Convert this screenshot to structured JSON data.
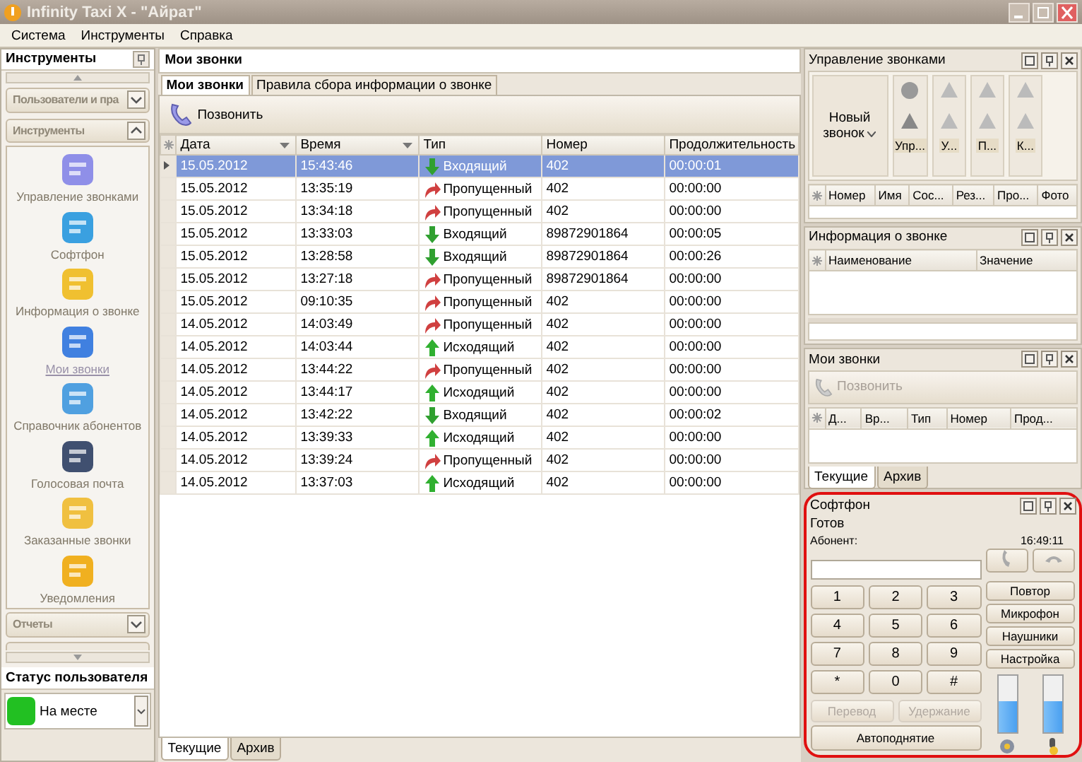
{
  "window": {
    "title": "Infinity Taxi X - \"Айрат\""
  },
  "menu": [
    "Система",
    "Инструменты",
    "Справка"
  ],
  "sidebar": {
    "title": "Инструменты",
    "groups_top": [
      {
        "label": "Пользователи и пра",
        "expanded": false
      },
      {
        "label": "Инструменты",
        "expanded": true
      }
    ],
    "items": [
      {
        "label": "Управление звонками",
        "selected": false
      },
      {
        "label": "Софтфон",
        "selected": false
      },
      {
        "label": "Информация о звонке",
        "selected": false
      },
      {
        "label": "Мои звонки",
        "selected": true
      },
      {
        "label": "Справочник абонентов",
        "selected": false
      },
      {
        "label": "Голосовая почта",
        "selected": false
      },
      {
        "label": "Заказанные звонки",
        "selected": false
      },
      {
        "label": "Уведомления",
        "selected": false
      }
    ],
    "groups_bottom": [
      {
        "label": "Отчеты",
        "expanded": false
      }
    ]
  },
  "user_status": {
    "title": "Статус пользователя",
    "value": "На месте",
    "color": "#22c022"
  },
  "main": {
    "title": "Мои звонки",
    "tabs": [
      {
        "label": "Мои звонки",
        "selected": true
      },
      {
        "label": "Правила сбора информации о звонке",
        "selected": false
      }
    ],
    "call_button": "Позвонить",
    "columns": [
      "Дата",
      "Время",
      "Тип",
      "Номер",
      "Продолжительность"
    ],
    "rows": [
      {
        "date": "15.05.2012",
        "time": "15:43:46",
        "kind": "incoming",
        "type": "Входящий",
        "number": "402",
        "duration": "00:00:01",
        "selected": true
      },
      {
        "date": "15.05.2012",
        "time": "13:35:19",
        "kind": "missed",
        "type": "Пропущенный",
        "number": "402",
        "duration": "00:00:00",
        "selected": false
      },
      {
        "date": "15.05.2012",
        "time": "13:34:18",
        "kind": "missed",
        "type": "Пропущенный",
        "number": "402",
        "duration": "00:00:00",
        "selected": false
      },
      {
        "date": "15.05.2012",
        "time": "13:33:03",
        "kind": "incoming",
        "type": "Входящий",
        "number": "89872901864",
        "duration": "00:00:05",
        "selected": false
      },
      {
        "date": "15.05.2012",
        "time": "13:28:58",
        "kind": "incoming",
        "type": "Входящий",
        "number": "89872901864",
        "duration": "00:00:26",
        "selected": false
      },
      {
        "date": "15.05.2012",
        "time": "13:27:18",
        "kind": "missed",
        "type": "Пропущенный",
        "number": "89872901864",
        "duration": "00:00:00",
        "selected": false
      },
      {
        "date": "15.05.2012",
        "time": "09:10:35",
        "kind": "missed",
        "type": "Пропущенный",
        "number": "402",
        "duration": "00:00:00",
        "selected": false
      },
      {
        "date": "14.05.2012",
        "time": "14:03:49",
        "kind": "missed",
        "type": "Пропущенный",
        "number": "402",
        "duration": "00:00:00",
        "selected": false
      },
      {
        "date": "14.05.2012",
        "time": "14:03:44",
        "kind": "outgoing",
        "type": "Исходящий",
        "number": "402",
        "duration": "00:00:00",
        "selected": false
      },
      {
        "date": "14.05.2012",
        "time": "13:44:22",
        "kind": "missed",
        "type": "Пропущенный",
        "number": "402",
        "duration": "00:00:00",
        "selected": false
      },
      {
        "date": "14.05.2012",
        "time": "13:44:17",
        "kind": "outgoing",
        "type": "Исходящий",
        "number": "402",
        "duration": "00:00:00",
        "selected": false
      },
      {
        "date": "14.05.2012",
        "time": "13:42:22",
        "kind": "incoming",
        "type": "Входящий",
        "number": "402",
        "duration": "00:00:02",
        "selected": false
      },
      {
        "date": "14.05.2012",
        "time": "13:39:33",
        "kind": "outgoing",
        "type": "Исходящий",
        "number": "402",
        "duration": "00:00:00",
        "selected": false
      },
      {
        "date": "14.05.2012",
        "time": "13:39:24",
        "kind": "missed",
        "type": "Пропущенный",
        "number": "402",
        "duration": "00:00:00",
        "selected": false
      },
      {
        "date": "14.05.2012",
        "time": "13:37:03",
        "kind": "outgoing",
        "type": "Исходящий",
        "number": "402",
        "duration": "00:00:00",
        "selected": false
      }
    ],
    "bottom_tabs": [
      {
        "label": "Текущие",
        "selected": true
      },
      {
        "label": "Архив",
        "selected": false
      }
    ]
  },
  "call_control": {
    "title": "Управление звонками",
    "new_call": "Новый звонок",
    "groups": [
      "Упр...",
      "У...",
      "П...",
      "К..."
    ],
    "columns": [
      "Номер",
      "Имя",
      "Сос...",
      "Рез...",
      "Про...",
      "Фото"
    ]
  },
  "call_info": {
    "title": "Информация о звонке",
    "columns": [
      "Наименование",
      "Значение"
    ]
  },
  "my_calls_panel": {
    "title": "Мои звонки",
    "call_button": {
      "label": "Позвонить",
      "disabled": true
    },
    "columns": [
      "Д...",
      "Вр...",
      "Тип",
      "Номер",
      "Прод..."
    ],
    "tabs": [
      {
        "label": "Текущие",
        "selected": true
      },
      {
        "label": "Архив",
        "selected": false
      }
    ]
  },
  "softphone": {
    "title": "Софтфон",
    "status": "Готов",
    "time": "16:49:11",
    "subscriber_label": "Абонент:",
    "keys": [
      "1",
      "2",
      "3",
      "4",
      "5",
      "6",
      "7",
      "8",
      "9",
      "*",
      "0",
      "#"
    ],
    "actions": [
      {
        "label": "Перевод",
        "disabled": true
      },
      {
        "label": "Удержание",
        "disabled": true
      }
    ],
    "auto_answer": "Автоподнятие",
    "side_buttons": [
      "Повтор",
      "Микрофон",
      "Наушники",
      "Настройка"
    ],
    "volumes": [
      {
        "level": 0.55
      },
      {
        "level": 0.55
      }
    ]
  }
}
